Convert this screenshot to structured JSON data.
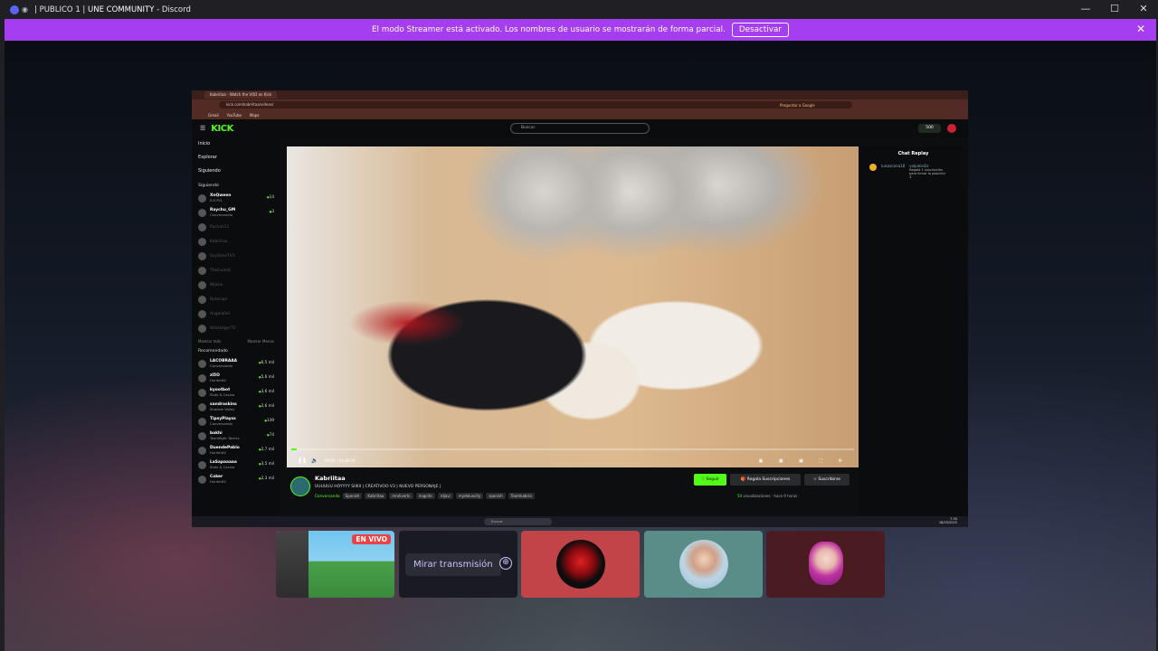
{
  "window": {
    "title_prefix": "| PUBLICO 1 |",
    "title_server": "UNE COMMUNITY",
    "title_suffix": "- Discord",
    "controls": {
      "minimize": "—",
      "maximize": "☐",
      "close": "✕"
    }
  },
  "banner": {
    "message": "El modo Streamer está activado. Los nombres de usuario se mostrarán de forma parcial.",
    "button": "Desactivar",
    "close": "✕"
  },
  "screen": {
    "browser_tab": "Kabriitaa - Watch the VOD on Kick",
    "url": "kick.com/kabriitaa/videos/",
    "ask_google": "Preguntar a Google",
    "bookmarks": [
      "Gmail",
      "YouTube",
      "Maps"
    ],
    "kick": {
      "logo": "KICK",
      "search_placeholder": "Buscar",
      "points": "500",
      "nav": [
        "Inicio",
        "Explorar",
        "Siguiendo"
      ],
      "following_title": "Siguiendo",
      "following": [
        {
          "name": "XnQween",
          "sub": "R.E.P.O.",
          "count": "14",
          "live": true
        },
        {
          "name": "Raychu_GM",
          "sub": "Conversando",
          "count": "3",
          "live": true
        },
        {
          "name": "Pachan11",
          "sub": "",
          "count": "",
          "live": false
        },
        {
          "name": "Kabriitaa",
          "sub": "",
          "count": "",
          "live": false
        },
        {
          "name": "SoySimeTV3",
          "sub": "",
          "count": "",
          "live": false
        },
        {
          "name": "TheGuardi",
          "sub": "",
          "count": "",
          "live": false
        },
        {
          "name": "Wijsen",
          "sub": "",
          "count": "",
          "live": false
        },
        {
          "name": "Bytecapr",
          "sub": "",
          "count": "",
          "live": false
        },
        {
          "name": "Angelafell",
          "sub": "",
          "count": "",
          "live": false
        },
        {
          "name": "WhitetigerTV",
          "sub": "",
          "count": "",
          "live": false
        }
      ],
      "show_more": "Mostrar más",
      "show_less": "Mostrar Menos",
      "recommended_title": "Recomendado",
      "recommended": [
        {
          "name": "LACOBRAAA",
          "sub": "Conversando",
          "count": "6,5 mil"
        },
        {
          "name": "zl5O",
          "sub": "Hunter82",
          "count": "5,6 mil"
        },
        {
          "name": "kyootbot",
          "sub": "Slots & Casino",
          "count": "3,6 mil"
        },
        {
          "name": "sandraskins",
          "sub": "Shadow Valley",
          "count": "2,6 mil"
        },
        {
          "name": "TipsyPlayss",
          "sub": "Conversando",
          "count": "139"
        },
        {
          "name": "bakhi",
          "sub": "Teamfight Tactics",
          "count": "74"
        },
        {
          "name": "DuendePablo",
          "sub": "Hunter82",
          "count": "2,7 mil"
        },
        {
          "name": "LaSapaaaaa",
          "sub": "Slots & Casino",
          "count": "3,5 mil"
        },
        {
          "name": "Coker",
          "sub": "Hunter82",
          "count": "2,3 mil"
        }
      ],
      "video": {
        "time": "00:02 / 03:48:59",
        "play": "❚❚",
        "volume": "🔈",
        "right_controls": "▣ ▣ ▣ ⛶ ⚙",
        "progress_fraction": 0.01
      },
      "streamer": "Kabriitaa",
      "stream_title": "UUUUUU HOYYYY SIIIIII | CREATIVOO V3 | NUEVO PERSONAJE |",
      "category": "Conversando",
      "tags": [
        "Spanish",
        "Kabriitaa",
        "mrolivertc",
        "riogcito",
        "rdjavi",
        "mydeluxcity",
        "spanish",
        "Teamkabria"
      ],
      "follow": "♡ Seguir",
      "gift": "🎁 Regala Suscripciones",
      "subscribe": "☆ Suscribirse",
      "views_count": "54",
      "views_text": "visualizaciones · hace 9 horas",
      "chat_title": "Chat Replay",
      "chat_msg_user1": "luisazcona18",
      "chat_msg_user2": "valpieiel2z",
      "chat_msg_text": "Regaló 1 suscripción para llenar la posición 3"
    },
    "taskbar": {
      "search": "Buscar",
      "clock_time": "7:30",
      "clock_date": "18/03/2025"
    }
  },
  "tiles": {
    "live_badge": "EN VIVO",
    "watch_button": "Mirar transmisión",
    "watch_icon": "⊕"
  }
}
